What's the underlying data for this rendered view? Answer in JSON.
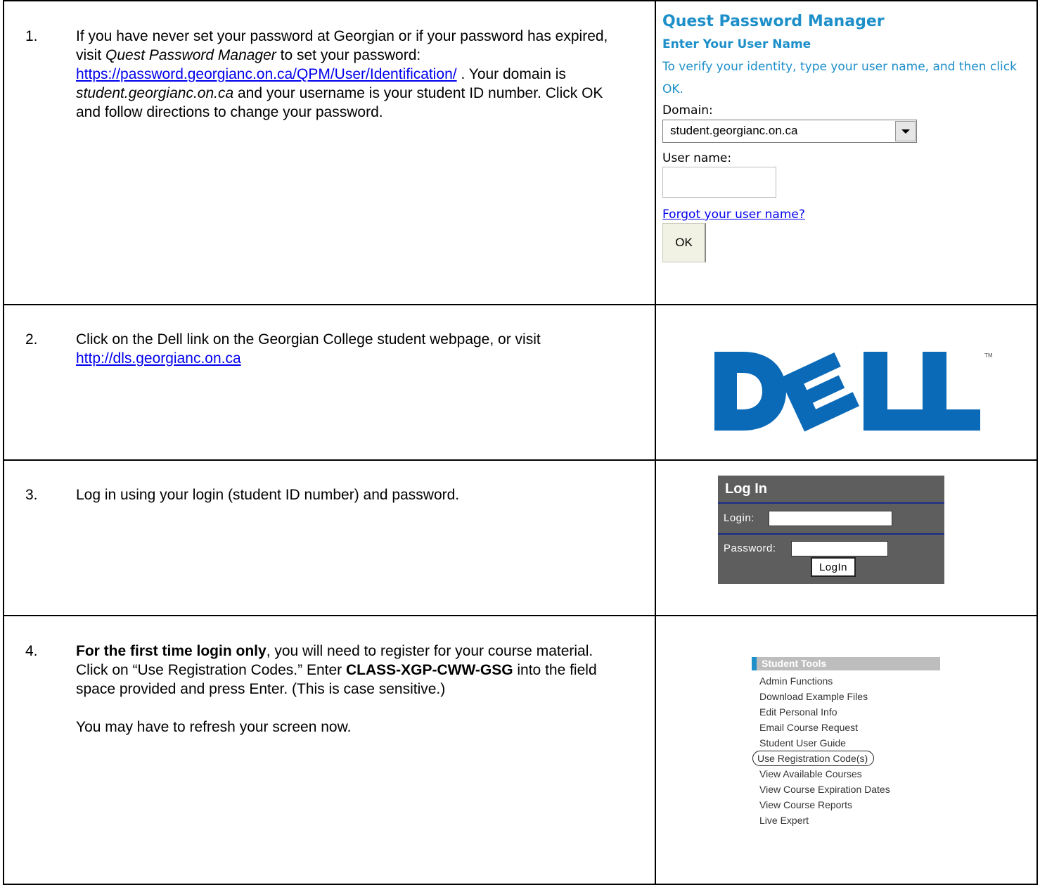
{
  "steps": [
    {
      "num": "1.",
      "text_a": "If you have never set your password at Georgian or if your password has expired, visit ",
      "text_a_em": "Quest Password Manager",
      "text_b": " to set your password: ",
      "link": "https://password.georgianc.on.ca/QPM/User/Identification/",
      "text_c": " . Your domain is ",
      "text_c_em": "student.georgianc.on.ca",
      "text_d": " and your username is your student ID number. Click OK and follow directions to change your password."
    },
    {
      "num": "2.",
      "text_a": "Click on the Dell link on the Georgian College student webpage, or visit ",
      "link": "http://dls.georgianc.on.ca"
    },
    {
      "num": "3.",
      "text_a": "Log in using your login (student ID number) and password."
    },
    {
      "num": "4.",
      "bold_a": "For the first time login only",
      "text_a": ", you will need to register for your course material. Click on “Use Registration Codes.”  Enter ",
      "bold_b": "CLASS-XGP-CWW-GSG",
      "text_b": " into the field space provided and press Enter. (This is case sensitive.)",
      "text_c": "You may have to refresh your screen now."
    }
  ],
  "qpm": {
    "title": "Quest Password Manager",
    "subtitle": "Enter Your User Name",
    "instruction": "To verify your identity, type your user name, and then click OK.",
    "domain_label": "Domain:",
    "domain_value": "student.georgianc.on.ca",
    "username_label": "User name:",
    "username_value": "",
    "forgot_link": "Forgot your user name?",
    "ok_button": "OK"
  },
  "dell": {
    "logo_text": "DELL",
    "color": "#0a6ab8"
  },
  "login_panel": {
    "title": "Log In",
    "login_label": "Login:",
    "password_label": "Password:",
    "button": "LogIn"
  },
  "student_tools": {
    "header": "Student Tools",
    "items": [
      "Admin Functions",
      "Download Example Files",
      "Edit Personal Info",
      "Email Course Request",
      "Student User Guide",
      "Use Registration Code(s)",
      "View Available Courses",
      "View Course Expiration Dates",
      "View Course Reports",
      "Live Expert"
    ],
    "circled_item_index": 5
  },
  "colors": {
    "qpm_accent": "#1d8fc9",
    "link": "#0000ee",
    "login_bg": "#5e5e5e"
  }
}
